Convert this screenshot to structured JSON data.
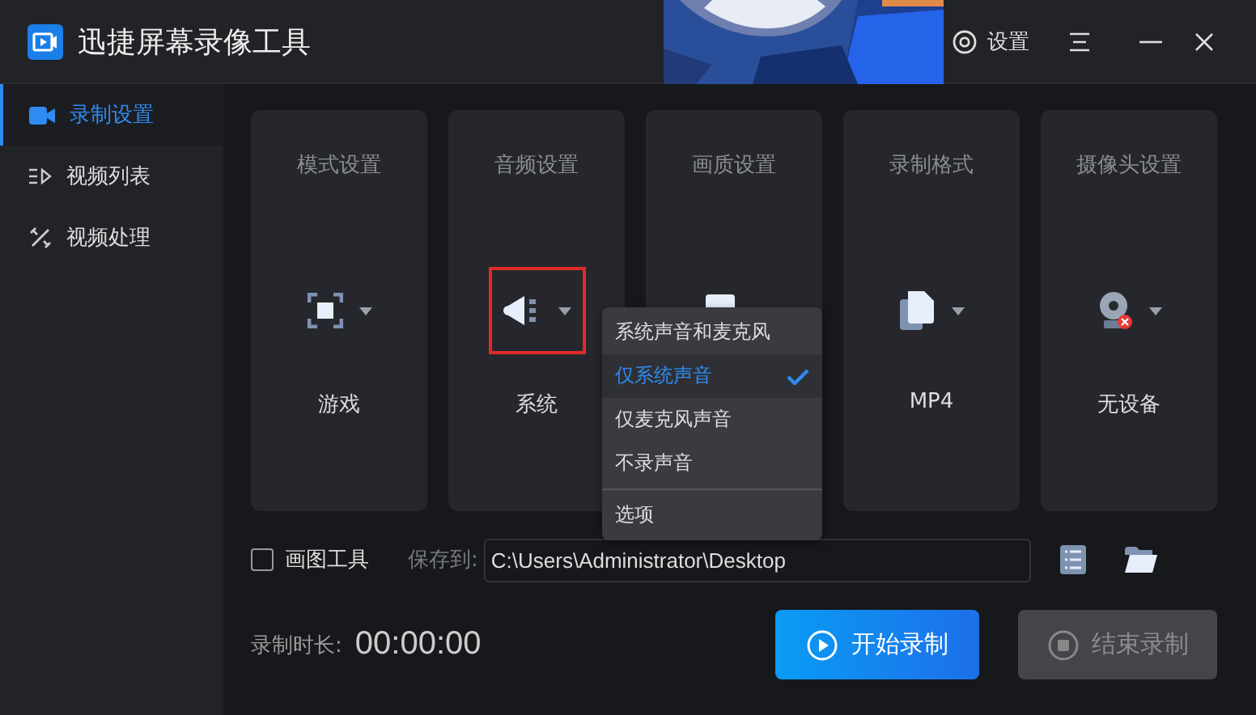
{
  "window": {
    "title": "迅捷屏幕录像工具"
  },
  "header": {
    "settings_label": "设置"
  },
  "sidebar": {
    "items": [
      {
        "label": "录制设置",
        "selected": true
      },
      {
        "label": "视频列表",
        "selected": false
      },
      {
        "label": "视频处理",
        "selected": false
      }
    ]
  },
  "cards": [
    {
      "title": "模式设置",
      "value": "游戏",
      "highlighted": false
    },
    {
      "title": "音频设置",
      "value": "系统",
      "highlighted": true
    },
    {
      "title": "画质设置",
      "highlighted": false
    },
    {
      "title": "录制格式",
      "value": "MP4",
      "highlighted": false
    },
    {
      "title": "摄像头设置",
      "value": "无设备",
      "highlighted": false
    }
  ],
  "audio_menu": {
    "items": [
      {
        "label": "系统声音和麦克风",
        "selected": false,
        "kind": "option"
      },
      {
        "label": "仅系统声音",
        "selected": true,
        "kind": "option"
      },
      {
        "label": "仅麦克风声音",
        "selected": false,
        "kind": "option"
      },
      {
        "label": "不录声音",
        "selected": false,
        "kind": "option"
      },
      {
        "label": "选项",
        "kind": "action"
      }
    ]
  },
  "draw_tool": {
    "label": "画图工具",
    "checked": false
  },
  "save_path": {
    "label": "保存到:",
    "value": "C:\\Users\\Administrator\\Desktop"
  },
  "duration": {
    "label": "录制时长:",
    "value": "00:00:00"
  },
  "buttons": [
    {
      "label": "开始录制",
      "disabled": false
    },
    {
      "label": "结束录制",
      "disabled": true
    }
  ]
}
